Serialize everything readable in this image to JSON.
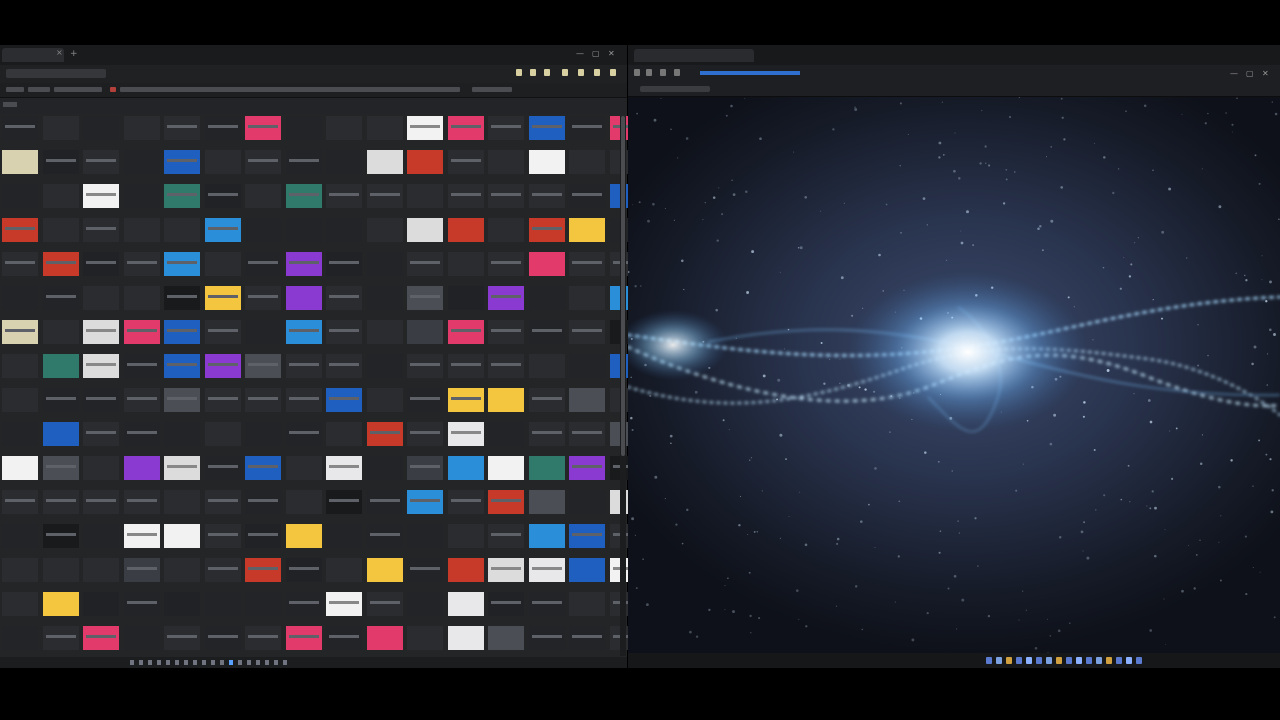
{
  "screen": {
    "left_window": {
      "role": "image-browser",
      "icons": {
        "tab_close": "×",
        "new_tab": "+",
        "minimize": "—",
        "maximize": "▢",
        "close": "✕"
      },
      "thumbnail_rows": 16,
      "thumbnail_cols": 16,
      "page_dots": 18,
      "active_page": 11
    },
    "right_window": {
      "role": "image-viewer",
      "icons": {
        "minimize": "—",
        "maximize": "▢",
        "close": "✕"
      }
    },
    "colors": {
      "accent": "#5aa0ff",
      "link": "#2f6fd0",
      "alert": "#b3403a",
      "glow": "#cfe9ff"
    }
  }
}
